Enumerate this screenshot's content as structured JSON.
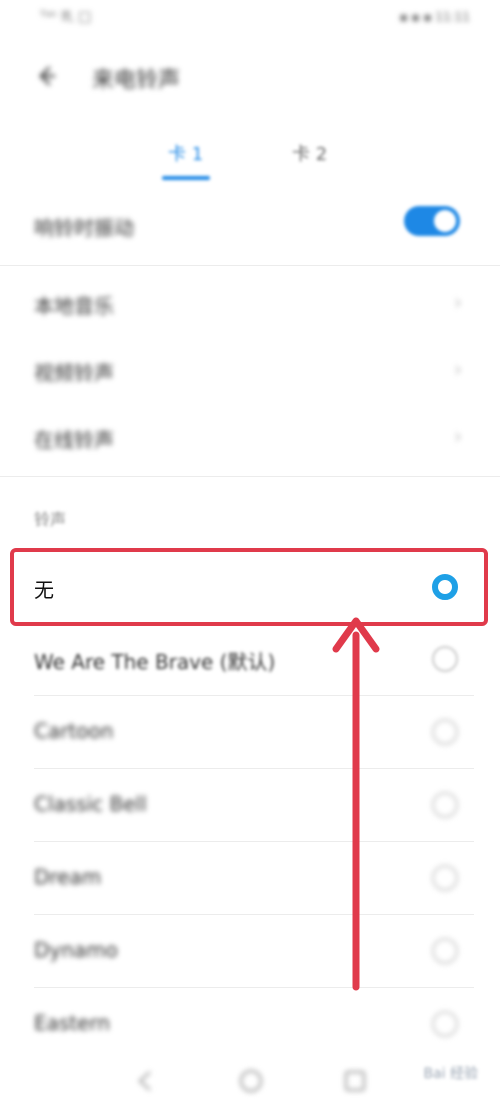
{
  "status_bar": {
    "left": "ᵀᵅⁿ ♏ □",
    "right": "▪ ▪ ▪ 11:11"
  },
  "header": {
    "title": "来电铃声"
  },
  "tabs": [
    {
      "label": "卡 1"
    },
    {
      "label": "卡 2"
    }
  ],
  "vibrate_row": {
    "label": "响铃时振动",
    "enabled": true
  },
  "menu_rows": [
    {
      "label": "本地音乐"
    },
    {
      "label": "视频铃声"
    },
    {
      "label": "在线铃声"
    }
  ],
  "section_title": "铃声",
  "ringtones": [
    {
      "name": "无",
      "selected": true
    },
    {
      "name": "We Are The Brave (默认)",
      "selected": false
    },
    {
      "name": "Cartoon",
      "selected": false
    },
    {
      "name": "Classic Bell",
      "selected": false
    },
    {
      "name": "Dream",
      "selected": false
    },
    {
      "name": "Dynamo",
      "selected": false
    },
    {
      "name": "Eastern",
      "selected": false
    }
  ],
  "watermark": "Bai 经验",
  "colors": {
    "accent": "#1e88e5",
    "highlight": "#e03a4b"
  }
}
